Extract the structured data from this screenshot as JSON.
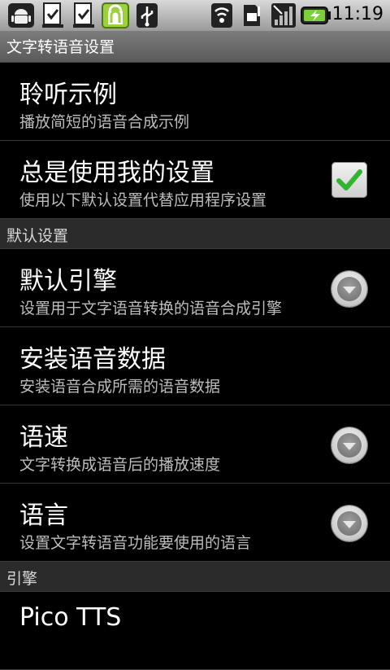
{
  "status_bar": {
    "time": "11:19",
    "icons": [
      "android-debug-icon",
      "sd-card-download-icon",
      "sd-card-download-icon",
      "android-market-icon",
      "usb-icon",
      "wifi-icon",
      "sim-card-icon",
      "signal-bars-icon",
      "battery-charging-icon"
    ]
  },
  "title_bar": {
    "title": "文字转语音设置"
  },
  "items": {
    "listen_example": {
      "title": "聆听示例",
      "summary": "播放简短的语音合成示例"
    },
    "always_use_mine": {
      "title": "总是使用我的设置",
      "summary": "使用以下默认设置代替应用程序设置",
      "checked": true
    }
  },
  "section_defaults": {
    "label": "默认设置"
  },
  "defaults": {
    "default_engine": {
      "title": "默认引擎",
      "summary": "设置用于文字语音转换的语音合成引擎"
    },
    "install_data": {
      "title": "安装语音数据",
      "summary": "安装语音合成所需的语音数据"
    },
    "speech_rate": {
      "title": "语速",
      "summary": "文字转换成语音后的播放速度"
    },
    "language": {
      "title": "语言",
      "summary": "设置文字转语音功能要使用的语言"
    }
  },
  "section_engines": {
    "label": "引擎"
  },
  "engines": {
    "pico": {
      "title": "Pico TTS"
    }
  },
  "colors": {
    "check_green": "#2fb52f",
    "section_bg": "#2b2b2b"
  }
}
